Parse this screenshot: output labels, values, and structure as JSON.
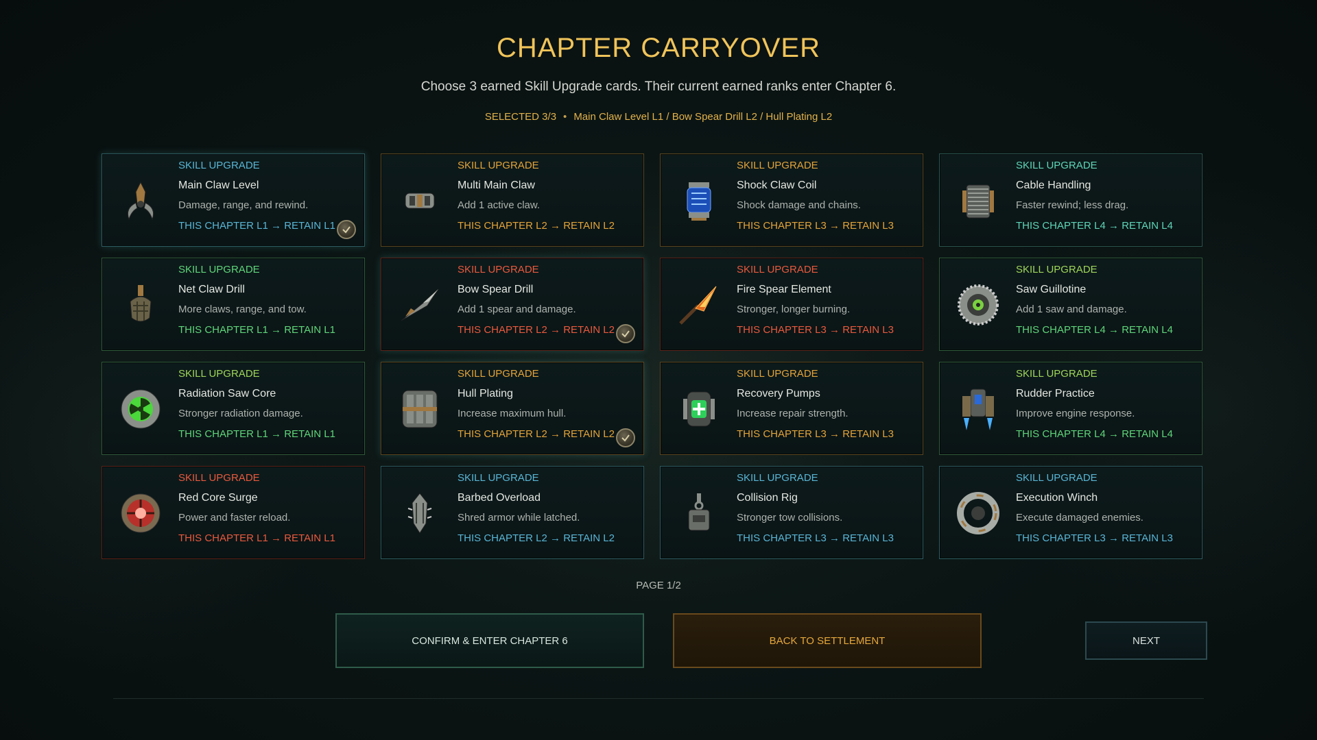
{
  "header": {
    "title": "CHAPTER CARRYOVER",
    "subtitle": "Choose 3 earned Skill Upgrade cards. Their current earned ranks enter Chapter 6.",
    "selected_count": "SELECTED 3/3",
    "separator": "•",
    "selected_list": "Main Claw Level L1 / Bow Spear Drill L2 / Hull Plating L2"
  },
  "cards": [
    {
      "kind": "SKILL UPGRADE",
      "name": "Main Claw Level",
      "desc": "Damage, range, and rewind.",
      "rank": "THIS CHAPTER L1 → RETAIN L1",
      "color": "blue",
      "icon": "claw-icon",
      "selected": true
    },
    {
      "kind": "SKILL UPGRADE",
      "name": "Multi Main Claw",
      "desc": "Add 1 active claw.",
      "rank": "THIS CHAPTER L2 → RETAIN L2",
      "color": "gold",
      "icon": "multi-claw-icon",
      "selected": false
    },
    {
      "kind": "SKILL UPGRADE",
      "name": "Shock Claw Coil",
      "desc": "Shock damage and chains.",
      "rank": "THIS CHAPTER L3 → RETAIN L3",
      "color": "gold",
      "icon": "shock-coil-icon",
      "selected": false
    },
    {
      "kind": "SKILL UPGRADE",
      "name": "Cable Handling",
      "desc": "Faster rewind; less drag.",
      "rank": "THIS CHAPTER L4 → RETAIN L4",
      "color": "teal",
      "icon": "cable-winch-icon",
      "selected": false
    },
    {
      "kind": "SKILL UPGRADE",
      "name": "Net Claw Drill",
      "desc": "More claws, range, and tow.",
      "rank": "THIS CHAPTER L1 → RETAIN L1",
      "color": "green",
      "icon": "net-claw-icon",
      "selected": false
    },
    {
      "kind": "SKILL UPGRADE",
      "name": "Bow Spear Drill",
      "desc": "Add 1 spear and damage.",
      "rank": "THIS CHAPTER L2 → RETAIN L2",
      "color": "red",
      "icon": "spear-icon",
      "selected": true
    },
    {
      "kind": "SKILL UPGRADE",
      "name": "Fire Spear Element",
      "desc": "Stronger, longer burning.",
      "rank": "THIS CHAPTER L3 → RETAIN L3",
      "color": "red",
      "icon": "fire-spear-icon",
      "selected": false
    },
    {
      "kind": "SKILL UPGRADE",
      "name": "Saw Guillotine",
      "desc": "Add 1 saw and damage.",
      "rank": "THIS CHAPTER L4 → RETAIN L4",
      "color": "lime",
      "icon": "saw-blade-icon",
      "selected": false
    },
    {
      "kind": "SKILL UPGRADE",
      "name": "Radiation Saw Core",
      "desc": "Stronger radiation damage.",
      "rank": "THIS CHAPTER L1 → RETAIN L1",
      "color": "lime",
      "icon": "radiation-core-icon",
      "selected": false
    },
    {
      "kind": "SKILL UPGRADE",
      "name": "Hull Plating",
      "desc": "Increase maximum hull.",
      "rank": "THIS CHAPTER L2 → RETAIN L2",
      "color": "gold",
      "icon": "hull-plate-icon",
      "selected": true
    },
    {
      "kind": "SKILL UPGRADE",
      "name": "Recovery Pumps",
      "desc": "Increase repair strength.",
      "rank": "THIS CHAPTER L3 → RETAIN L3",
      "color": "gold",
      "icon": "repair-pump-icon",
      "selected": false
    },
    {
      "kind": "SKILL UPGRADE",
      "name": "Rudder Practice",
      "desc": "Improve engine response.",
      "rank": "THIS CHAPTER L4 → RETAIN L4",
      "color": "lime",
      "icon": "engine-icon",
      "selected": false
    },
    {
      "kind": "SKILL UPGRADE",
      "name": "Red Core Surge",
      "desc": "Power and faster reload.",
      "rank": "THIS CHAPTER L1 → RETAIN L1",
      "color": "red",
      "icon": "red-core-icon",
      "selected": false
    },
    {
      "kind": "SKILL UPGRADE",
      "name": "Barbed Overload",
      "desc": "Shred armor while latched.",
      "rank": "THIS CHAPTER L2 → RETAIN L2",
      "color": "blue",
      "icon": "barbed-icon",
      "selected": false
    },
    {
      "kind": "SKILL UPGRADE",
      "name": "Collision Rig",
      "desc": "Stronger tow collisions.",
      "rank": "THIS CHAPTER L3 → RETAIN L3",
      "color": "blue",
      "icon": "collision-rig-icon",
      "selected": false
    },
    {
      "kind": "SKILL UPGRADE",
      "name": "Execution Winch",
      "desc": "Execute damaged enemies.",
      "rank": "THIS CHAPTER L3 → RETAIN L3",
      "color": "blue",
      "icon": "winch-ring-icon",
      "selected": false
    }
  ],
  "pagination": {
    "label": "PAGE 1/2"
  },
  "buttons": {
    "confirm": "CONFIRM & ENTER CHAPTER 6",
    "back": "BACK TO SETTLEMENT",
    "next": "NEXT"
  },
  "palette": {
    "title": "#f0c45a",
    "blue": "#59b6d6",
    "gold": "#e3a43a",
    "green": "#5fd67a",
    "teal": "#5fd6b8",
    "red": "#e85a3e",
    "lime": "#9fd65a"
  }
}
